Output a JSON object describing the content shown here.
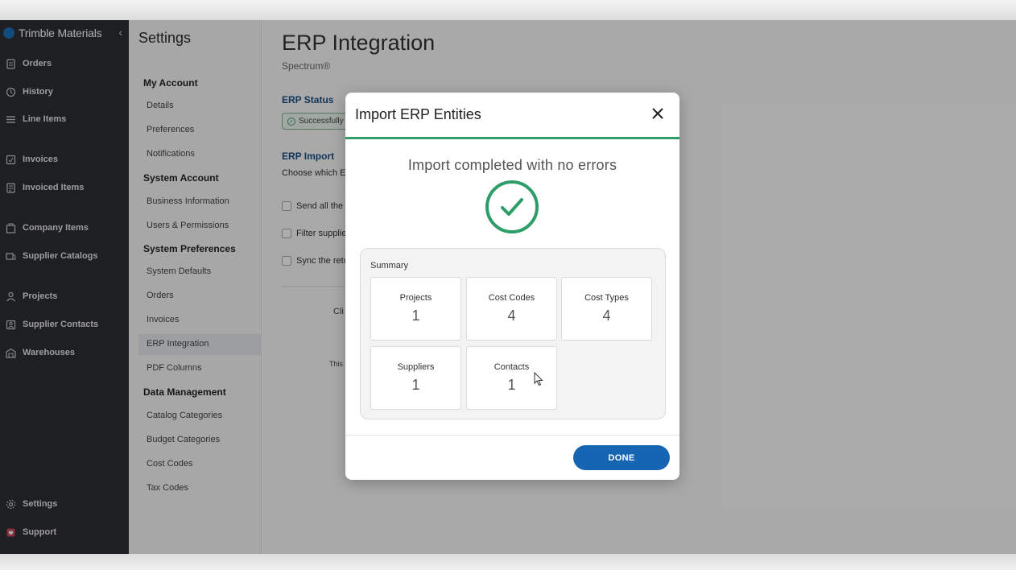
{
  "brand": {
    "name": "Trimble Materials"
  },
  "nav": {
    "items": [
      {
        "label": "Orders",
        "icon": "orders-icon"
      },
      {
        "label": "History",
        "icon": "history-icon"
      },
      {
        "label": "Line Items",
        "icon": "line-items-icon"
      },
      {
        "label": "Invoices",
        "icon": "invoices-icon"
      },
      {
        "label": "Invoiced Items",
        "icon": "invoiced-items-icon"
      },
      {
        "label": "Company Items",
        "icon": "company-items-icon"
      },
      {
        "label": "Supplier Catalogs",
        "icon": "supplier-catalogs-icon"
      },
      {
        "label": "Projects",
        "icon": "projects-icon"
      },
      {
        "label": "Supplier Contacts",
        "icon": "supplier-contacts-icon"
      },
      {
        "label": "Warehouses",
        "icon": "warehouses-icon"
      },
      {
        "label": "Settings",
        "icon": "settings-icon"
      },
      {
        "label": "Support",
        "icon": "support-icon"
      }
    ]
  },
  "settings": {
    "title": "Settings",
    "sections": [
      {
        "title": "My Account",
        "links": [
          "Details",
          "Preferences",
          "Notifications"
        ]
      },
      {
        "title": "System Account",
        "links": [
          "Business Information",
          "Users & Permissions"
        ]
      },
      {
        "title": "System Preferences",
        "links": [
          "System Defaults",
          "Orders",
          "Invoices",
          "ERP Integration",
          "PDF Columns"
        ]
      },
      {
        "title": "Data Management",
        "links": [
          "Catalog Categories",
          "Budget Categories",
          "Cost Codes",
          "Tax Codes"
        ]
      }
    ],
    "active": "ERP Integration"
  },
  "main": {
    "title": "ERP Integration",
    "subtitle": "Spectrum®",
    "erp_status_heading": "ERP Status",
    "status_badge": "Successfully",
    "erp_import_heading": "ERP Import",
    "import_text": "Choose which EF",
    "checkboxes": [
      "Send all the F",
      "Filter supplie",
      "Sync the retu"
    ],
    "fragment_1": "Cli",
    "fragment_2": "This"
  },
  "modal": {
    "title": "Import ERP Entities",
    "message": "Import completed with no errors",
    "summary_label": "Summary",
    "cards": [
      {
        "label": "Projects",
        "value": "1"
      },
      {
        "label": "Cost Codes",
        "value": "4"
      },
      {
        "label": "Cost Types",
        "value": "4"
      },
      {
        "label": "Suppliers",
        "value": "1"
      },
      {
        "label": "Contacts",
        "value": "1"
      }
    ],
    "done_label": "DONE"
  },
  "colors": {
    "nav_bg": "#2c2f33",
    "accent_green": "#2e9d6a",
    "primary_blue": "#1565b3",
    "heading_blue": "#1b4f86"
  }
}
